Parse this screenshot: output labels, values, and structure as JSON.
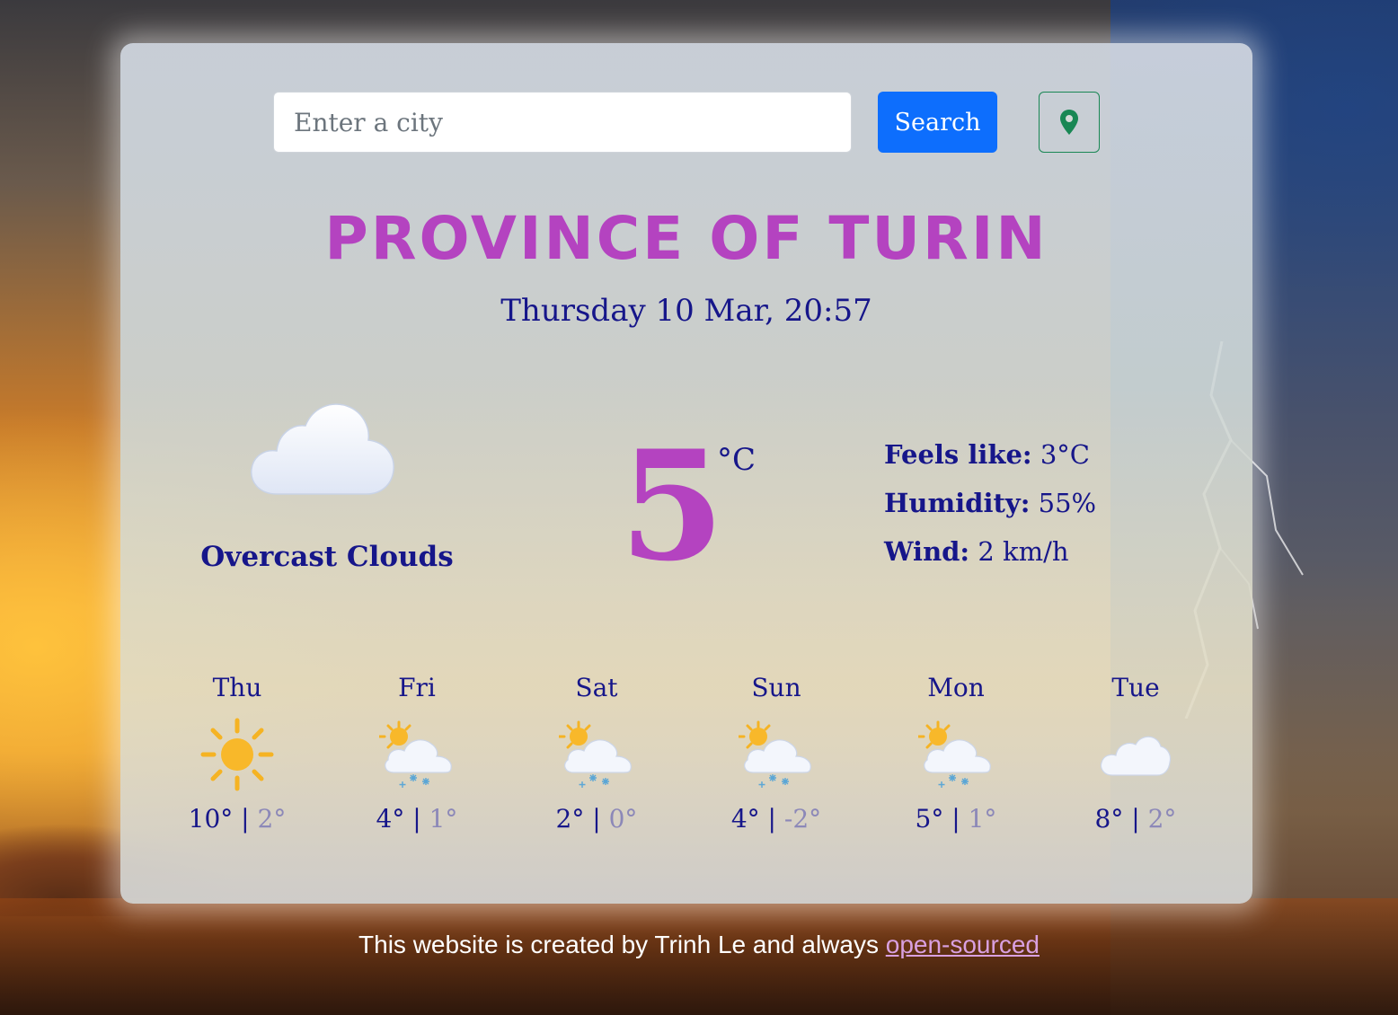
{
  "search": {
    "placeholder": "Enter a city",
    "value": "",
    "button_label": "Search",
    "location_icon": "map-pin-icon"
  },
  "current": {
    "city": "PROVINCE OF TURIN",
    "datetime": "Thursday 10 Mar, 20:57",
    "icon": "cloud-icon",
    "description": "Overcast Clouds",
    "temperature": "5",
    "unit": "°C",
    "feels_like_label": "Feels like:",
    "feels_like": "3°C",
    "humidity_label": "Humidity:",
    "humidity": "55%",
    "wind_label": "Wind:",
    "wind": "2 km/h"
  },
  "forecast": [
    {
      "day": "Thu",
      "icon": "sun-icon",
      "max": "10°",
      "min": "2°"
    },
    {
      "day": "Fri",
      "icon": "sun-cloud-snow-icon",
      "max": "4°",
      "min": "1°"
    },
    {
      "day": "Sat",
      "icon": "sun-cloud-snow-icon",
      "max": "2°",
      "min": "0°"
    },
    {
      "day": "Sun",
      "icon": "sun-cloud-snow-icon",
      "max": "4°",
      "min": "-2°"
    },
    {
      "day": "Mon",
      "icon": "sun-cloud-snow-icon",
      "max": "5°",
      "min": "1°"
    },
    {
      "day": "Tue",
      "icon": "cloud-icon",
      "max": "8°",
      "min": "2°"
    }
  ],
  "footer": {
    "text": "This website is created by Trinh Le and always ",
    "link": "open-sourced"
  },
  "colors": {
    "accent": "#b443c0",
    "text": "#16168a",
    "primary_button": "#0d6efd",
    "location_button": "#198754",
    "min_temp": "#8c88b8"
  }
}
